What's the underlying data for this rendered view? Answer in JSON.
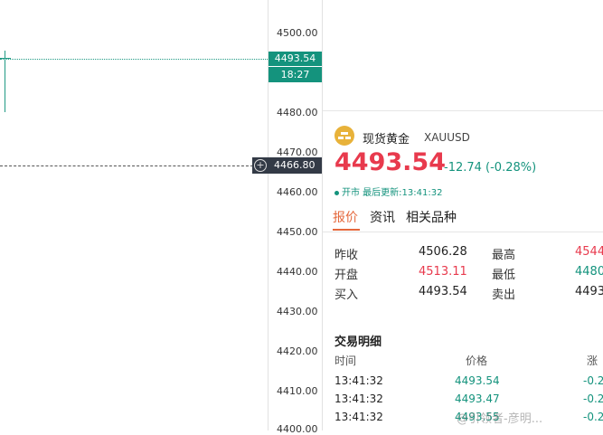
{
  "chart": {
    "axis_ticks": [
      "4500.00",
      "4480.00",
      "4470.00",
      "4460.00",
      "4450.00",
      "4440.00",
      "4430.00",
      "4420.00",
      "4410.00",
      "4400.00"
    ],
    "current_price_tag": "4493.54",
    "time_tag": "18:27",
    "crosshair_value": "4466.80",
    "colors": {
      "up": "#14937d",
      "down": "#e83a4d",
      "crosshair_tag": "#333a46"
    }
  },
  "quote": {
    "name": "现货黄金",
    "code": "XAUUSD",
    "price": "4493.54",
    "change": "-12.74 (-0.28%)",
    "status": "开市 最后更新:13:41:32",
    "tabs": [
      "报价",
      "资讯",
      "相关品种"
    ],
    "stats": {
      "prev_close_label": "昨收",
      "prev_close": "4506.28",
      "high_label": "最高",
      "high": "4544",
      "open_label": "开盘",
      "open": "4513.11",
      "low_label": "最低",
      "low": "4480",
      "bid_label": "买入",
      "bid": "4493.54",
      "ask_label": "卖出",
      "ask": "4493"
    }
  },
  "trades": {
    "title": "交易明细",
    "headers": [
      "时间",
      "价格",
      "涨"
    ],
    "rows": [
      {
        "time": "13:41:32",
        "price": "4493.54",
        "change": "-0.2"
      },
      {
        "time": "13:41:32",
        "price": "4493.47",
        "change": "-0.2"
      },
      {
        "time": "13:41:32",
        "price": "4493.55",
        "change": "-0.2"
      }
    ]
  },
  "watermark": "@引领者-彦明..."
}
